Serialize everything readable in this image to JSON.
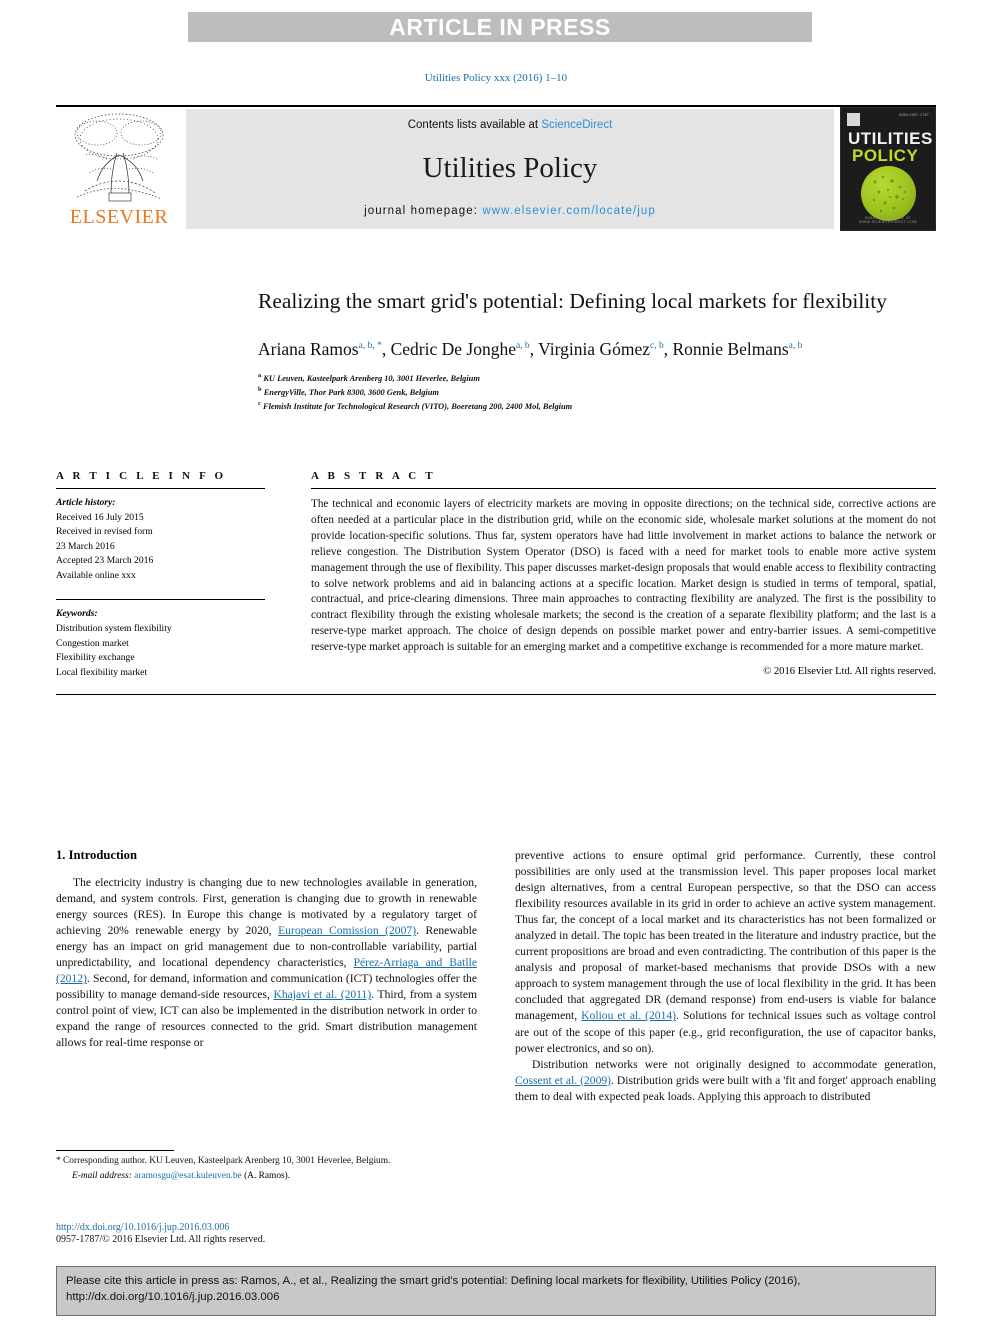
{
  "banner": {
    "label": "ARTICLE IN PRESS"
  },
  "journal_ref": "Utilities Policy xxx (2016) 1–10",
  "masthead": {
    "publisher": "ELSEVIER",
    "contents_prefix": "Contents lists available at ",
    "contents_link": "ScienceDirect",
    "journal_title": "Utilities Policy",
    "homepage_prefix": "journal homepage: ",
    "homepage_link": "www.elsevier.com/locate/jup",
    "cover": {
      "title_line1": "UTILITIES",
      "title_line2": "POLICY",
      "issn_corner": "ISSN 0957-1787",
      "footer": "AVAILABLE ONLINE AT WWW.SCIENCEDIRECT.COM"
    }
  },
  "article": {
    "title": "Realizing the smart grid's potential: Defining local markets for flexibility",
    "authors": [
      {
        "name": "Ariana Ramos",
        "marks": "a, b, *"
      },
      {
        "name": "Cedric De Jonghe",
        "marks": "a, b"
      },
      {
        "name": "Virginia Gómez",
        "marks": "c, b"
      },
      {
        "name": "Ronnie Belmans",
        "marks": "a, b"
      }
    ],
    "affiliations": [
      {
        "mark": "a",
        "text": "KU Leuven, Kasteelpark Arenberg 10, 3001 Heverlee, Belgium"
      },
      {
        "mark": "b",
        "text": "EnergyVille, Thor Park 8300, 3600 Genk, Belgium"
      },
      {
        "mark": "c",
        "text": "Flemish Institute for Technological Research (VITO), Boeretang 200, 2400 Mol, Belgium"
      }
    ]
  },
  "article_info": {
    "heading": "A R T I C L E   I N F O",
    "history_label": "Article history:",
    "history": [
      "Received 16 July 2015",
      "Received in revised form",
      "23 March 2016",
      "Accepted 23 March 2016",
      "Available online xxx"
    ],
    "keywords_label": "Keywords:",
    "keywords": [
      "Distribution system flexibility",
      "Congestion market",
      "Flexibility exchange",
      "Local flexibility market"
    ]
  },
  "abstract": {
    "heading": "A B S T R A C T",
    "text": "The technical and economic layers of electricity markets are moving in opposite directions; on the technical side, corrective actions are often needed at a particular place in the distribution grid, while on the economic side, wholesale market solutions at the moment do not provide location-specific solutions. Thus far, system operators have had little involvement in market actions to balance the network or relieve congestion. The Distribution System Operator (DSO) is faced with a need for market tools to enable more active system management through the use of flexibility. This paper discusses market-design proposals that would enable access to flexibility contracting to solve network problems and aid in balancing actions at a specific location. Market design is studied in terms of temporal, spatial, contractual, and price-clearing dimensions. Three main approaches to contracting flexibility are analyzed. The first is the possibility to contract flexibility through the existing wholesale markets; the second is the creation of a separate flexibility platform; and the last is a reserve-type market approach. The choice of design depends on possible market power and entry-barrier issues. A semi-competitive reserve-type market approach is suitable for an emerging market and a competitive exchange is recommended for a more mature market.",
    "copyright": "© 2016 Elsevier Ltd. All rights reserved."
  },
  "introduction": {
    "section_number_title": "1.  Introduction",
    "left_para_1_a": "The electricity industry is changing due to new technologies available in generation, demand, and system controls. First, generation is changing due to growth in renewable energy sources (RES). In Europe this change is motivated by a regulatory target of achieving 20% renewable energy by 2020, ",
    "left_cite_1": "European Comission (2007)",
    "left_para_1_b": ". Renewable energy has an impact on grid management due to non-controllable variability, partial unpredictability, and locational dependency characteristics, ",
    "left_cite_2": "Pérez-Arriaga and Batlle (2012)",
    "left_para_1_c": ". Second, for demand, information and communication (ICT) technologies offer the possibility to manage demand-side resources, ",
    "left_cite_3": "Khajavi et al. (2011)",
    "left_para_1_d": ". Third, from a system control point of view, ICT can also be implemented in the distribution network in order to expand the range of resources connected to the grid. Smart distribution management allows for real-time response or",
    "right_para_1_a": "preventive actions to ensure optimal grid performance. Currently, these control possibilities are only used at the transmission level. This paper proposes local market design alternatives, from a central European perspective, so that the DSO can access flexibility resources available in its grid in order to achieve an active system management. Thus far, the concept of a local market and its characteristics has not been formalized or analyzed in detail. The topic has been treated in the literature and industry practice, but the current propositions are broad and even contradicting. The contribution of this paper is the analysis and proposal of market-based mechanisms that provide DSOs with a new approach to system management through the use of local flexibility in the grid. It has been concluded that aggregated DR (demand response) from end-users is viable for balance management, ",
    "right_cite_1": "Koliou et al. (2014)",
    "right_para_1_b": ". Solutions for technical issues such as voltage control are out of the scope of this paper (e.g., grid reconfiguration, the use of capacitor banks, power electronics, and so on).",
    "right_para_2_a": "Distribution networks were not originally designed to accommodate generation, ",
    "right_cite_2": "Cossent et al. (2009)",
    "right_para_2_b": ". Distribution grids were built with a 'fit and forget' approach enabling them to deal with expected peak loads. Applying this approach to distributed"
  },
  "footnotes": {
    "corresponding": "* Corresponding author. KU Leuven, Kasteelpark Arenberg 10, 3001 Heverlee, Belgium.",
    "email_label": "E-mail address: ",
    "email_link": "aramosgu@esat.kuleuven.be",
    "email_suffix": " (A. Ramos).",
    "doi": "http://dx.doi.org/10.1016/j.jup.2016.03.006",
    "issn": "0957-1787/© 2016 Elsevier Ltd. All rights reserved."
  },
  "cite_footer": {
    "text": "Please cite this article in press as: Ramos, A., et al., Realizing the smart grid's potential: Defining local markets for flexibility, Utilities Policy (2016), http://dx.doi.org/10.1016/j.jup.2016.03.006"
  },
  "colors": {
    "link": "#1a6ea8",
    "banner_bg": "#bdbdbd",
    "masthead_bg": "#e4e4e4",
    "elsevier_orange": "#e87722",
    "cover_accent": "#c3d92b"
  }
}
